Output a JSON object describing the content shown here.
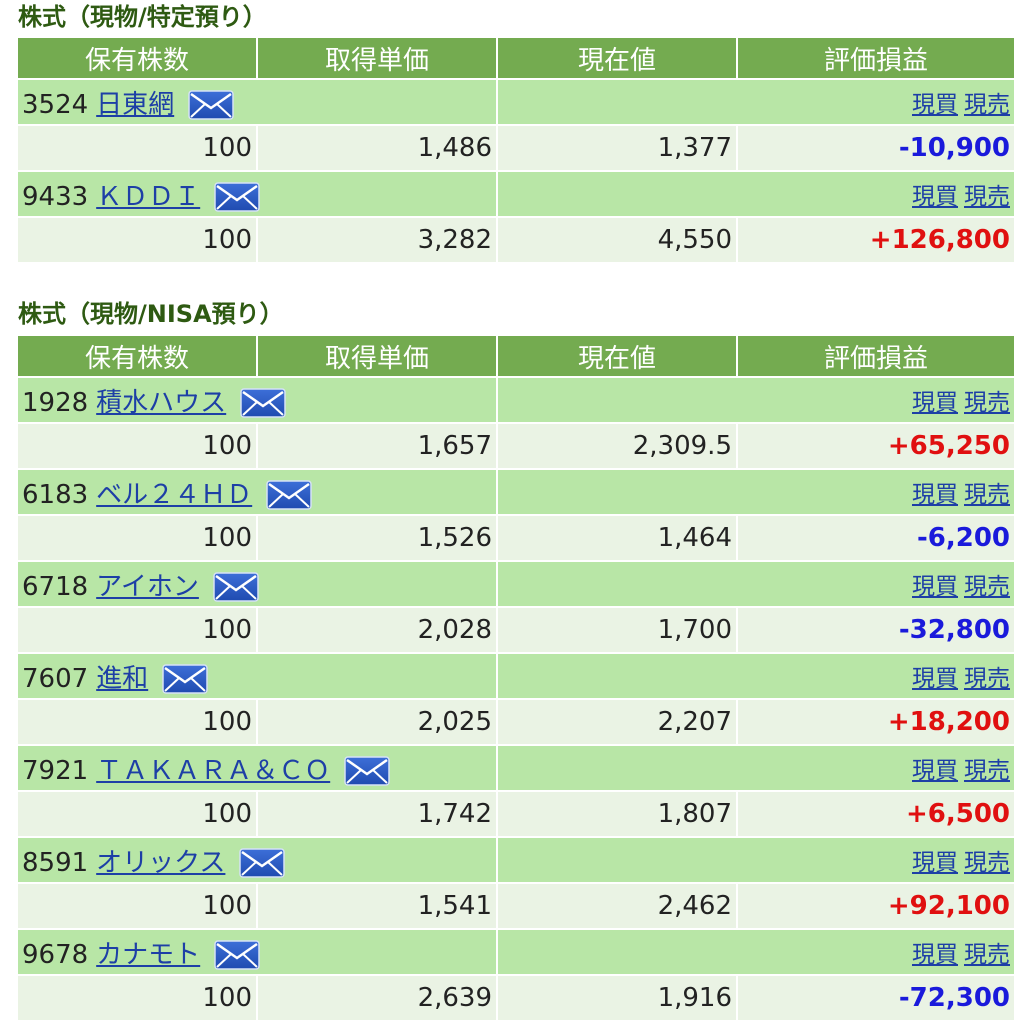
{
  "sections": [
    {
      "title": "株式（現物/特定預り）",
      "headers": [
        "保有株数",
        "取得単価",
        "現在値",
        "評価損益"
      ],
      "buy_label": "現買",
      "sell_label": "現売",
      "rows": [
        {
          "code": "3524",
          "name": "日東網",
          "shares": "100",
          "cost": "1,486",
          "price": "1,377",
          "pl": "-10,900",
          "sign": "neg"
        },
        {
          "code": "9433",
          "name": "ＫＤＤＩ",
          "shares": "100",
          "cost": "3,282",
          "price": "4,550",
          "pl": "+126,800",
          "sign": "pos"
        }
      ]
    },
    {
      "title": "株式（現物/NISA預り）",
      "headers": [
        "保有株数",
        "取得単価",
        "現在値",
        "評価損益"
      ],
      "buy_label": "現買",
      "sell_label": "現売",
      "rows": [
        {
          "code": "1928",
          "name": "積水ハウス",
          "shares": "100",
          "cost": "1,657",
          "price": "2,309.5",
          "pl": "+65,250",
          "sign": "pos"
        },
        {
          "code": "6183",
          "name": "ベル２４ＨＤ",
          "shares": "100",
          "cost": "1,526",
          "price": "1,464",
          "pl": "-6,200",
          "sign": "neg"
        },
        {
          "code": "6718",
          "name": "アイホン",
          "shares": "100",
          "cost": "2,028",
          "price": "1,700",
          "pl": "-32,800",
          "sign": "neg"
        },
        {
          "code": "7607",
          "name": "進和",
          "shares": "100",
          "cost": "2,025",
          "price": "2,207",
          "pl": "+18,200",
          "sign": "pos"
        },
        {
          "code": "7921",
          "name": "ＴＡＫＡＲＡ＆ＣＯ",
          "shares": "100",
          "cost": "1,742",
          "price": "1,807",
          "pl": "+6,500",
          "sign": "pos"
        },
        {
          "code": "8591",
          "name": "オリックス",
          "shares": "100",
          "cost": "1,541",
          "price": "2,462",
          "pl": "+92,100",
          "sign": "pos"
        },
        {
          "code": "9678",
          "name": "カナモト",
          "shares": "100",
          "cost": "2,639",
          "price": "1,916",
          "pl": "-72,300",
          "sign": "neg"
        }
      ]
    }
  ],
  "colors": {
    "header_bg": "#74ab50",
    "name_row_bg": "#b8e6a6",
    "value_row_bg": "#eaf3e4",
    "section_title": "#2e5a12",
    "link": "#1d3fa6",
    "loss": "#1a1adb",
    "gain": "#e01010"
  },
  "icons": {
    "mail": "mail-icon"
  }
}
